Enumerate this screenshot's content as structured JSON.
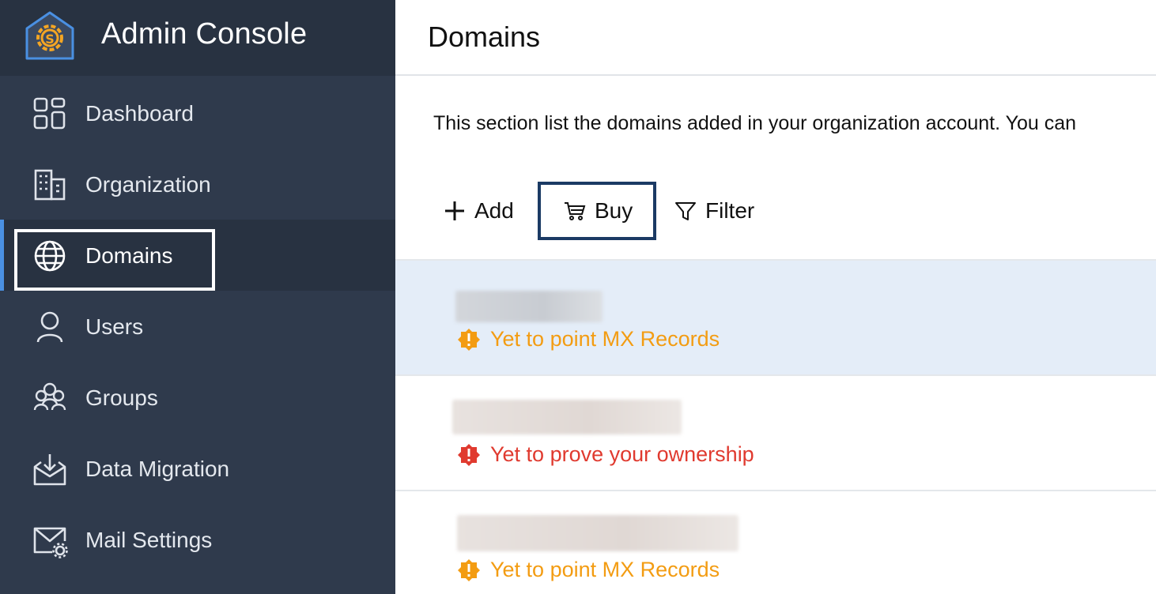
{
  "app": {
    "title": "Admin Console"
  },
  "sidebar": {
    "items": [
      {
        "label": "Dashboard",
        "icon": "dashboard-icon"
      },
      {
        "label": "Organization",
        "icon": "building-icon"
      },
      {
        "label": "Domains",
        "icon": "globe-icon",
        "active": true
      },
      {
        "label": "Users",
        "icon": "user-icon"
      },
      {
        "label": "Groups",
        "icon": "group-icon"
      },
      {
        "label": "Data Migration",
        "icon": "inbox-download-icon"
      },
      {
        "label": "Mail Settings",
        "icon": "mail-settings-icon"
      }
    ]
  },
  "page": {
    "title": "Domains",
    "description": "This section list the domains added in your organization account. You can"
  },
  "toolbar": {
    "add_label": "Add",
    "buy_label": "Buy",
    "filter_label": "Filter"
  },
  "domains": [
    {
      "status": "Yet to point MX Records",
      "status_type": "warning",
      "status_color": "#f39c12"
    },
    {
      "status": "Yet to prove your ownership",
      "status_type": "error",
      "status_color": "#e03a2f"
    },
    {
      "status": "Yet to point MX Records",
      "status_type": "warning",
      "status_color": "#f39c12"
    }
  ],
  "colors": {
    "sidebar": "#2f3a4c",
    "sidebar_header": "#283241",
    "accent": "#f5a623",
    "focus_border": "#1b3a64",
    "selected_row": "#e4edf8"
  }
}
